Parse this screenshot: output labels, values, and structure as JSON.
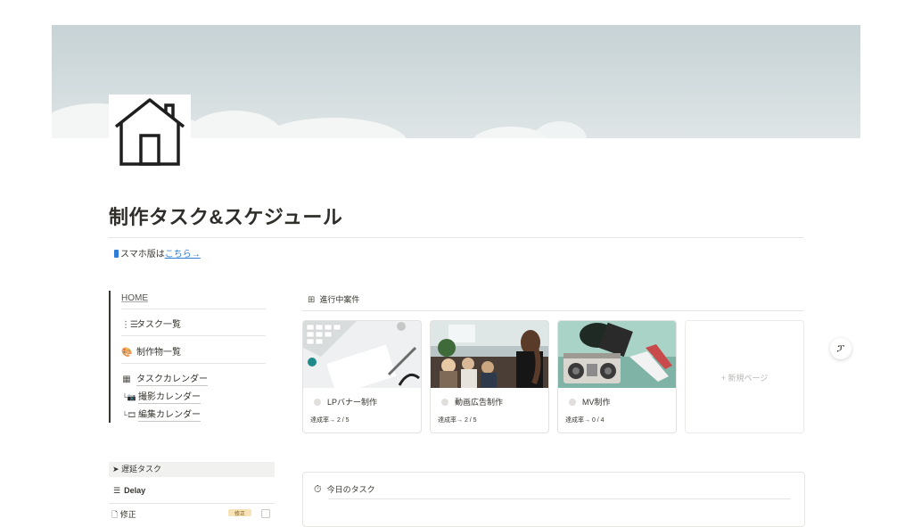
{
  "page": {
    "title": "制作タスク&スケジュール",
    "mobile_prefix": "スマホ版は",
    "mobile_link": "こちら→"
  },
  "sidebar": {
    "home": "HOME",
    "items": [
      {
        "icon": "list-icon",
        "glyph": "⋮☰",
        "label": "タスク一覧"
      },
      {
        "icon": "palette-icon",
        "glyph": "🎨",
        "label": "制作物一覧"
      },
      {
        "icon": "calendar-icon",
        "glyph": "▦",
        "label": "タスクカレンダー"
      },
      {
        "icon": "camera-calendar-icon",
        "glyph": "└📷",
        "label": "撮影カレンダー"
      },
      {
        "icon": "edit-calendar-icon",
        "glyph": "└🎞",
        "label": "編集カレンダー"
      }
    ]
  },
  "projects": {
    "heading": "進行中案件",
    "cards": [
      {
        "name": "LPバナー制作",
        "rate": "達成率→ 2 / 5"
      },
      {
        "name": "動画広告制作",
        "rate": "達成率→ 2 / 5"
      },
      {
        "name": "MV制作",
        "rate": "達成率→ 0 / 4"
      }
    ],
    "new_page": "+ 新規ページ"
  },
  "delay": {
    "heading": "➤ 遅延タスク",
    "view": "Delay",
    "row_text": "修正",
    "row_tag": "修正"
  },
  "today": {
    "title": "今日のタスク"
  },
  "side_button": "ፓ"
}
